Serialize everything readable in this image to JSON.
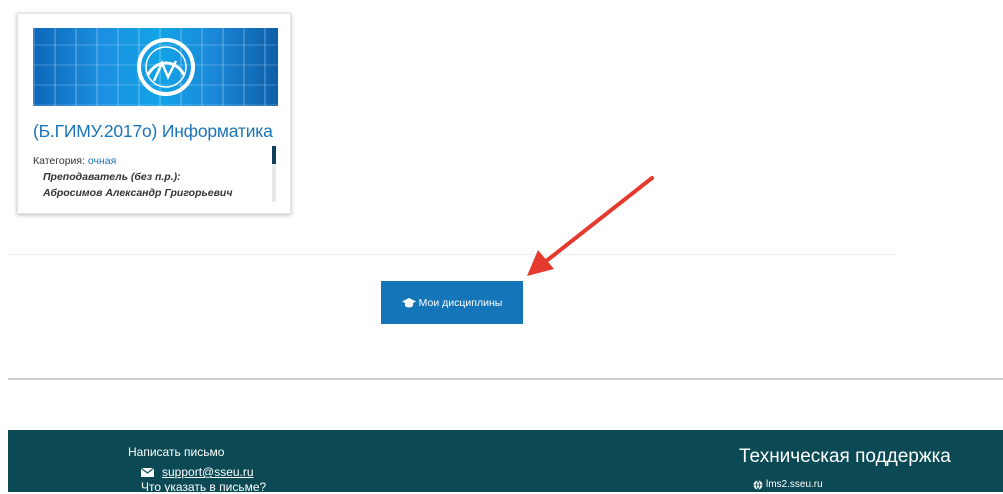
{
  "course_card": {
    "title": "(Б.ГИМУ.2017о) Информатика",
    "category_label": "Категория: ",
    "category_value": "очная",
    "teacher_role": "Преподаватель (без п.р.):",
    "teacher_name": "Абросимов Александр Григорьевич"
  },
  "main": {
    "my_courses_label": "Мои дисциплины",
    "button_icon": "graduation-cap-icon"
  },
  "footer": {
    "write_heading": "Написать письмо",
    "email": "support@sseu.ru",
    "what_to_write": "Что указать в письме?",
    "support_heading": "Техническая поддержка",
    "site": "lms2.sseu.ru"
  },
  "colors": {
    "accent": "#1575b9",
    "link": "#1b74b8",
    "footer_bg": "#0b4a55",
    "arrow": "#e53a2e"
  }
}
